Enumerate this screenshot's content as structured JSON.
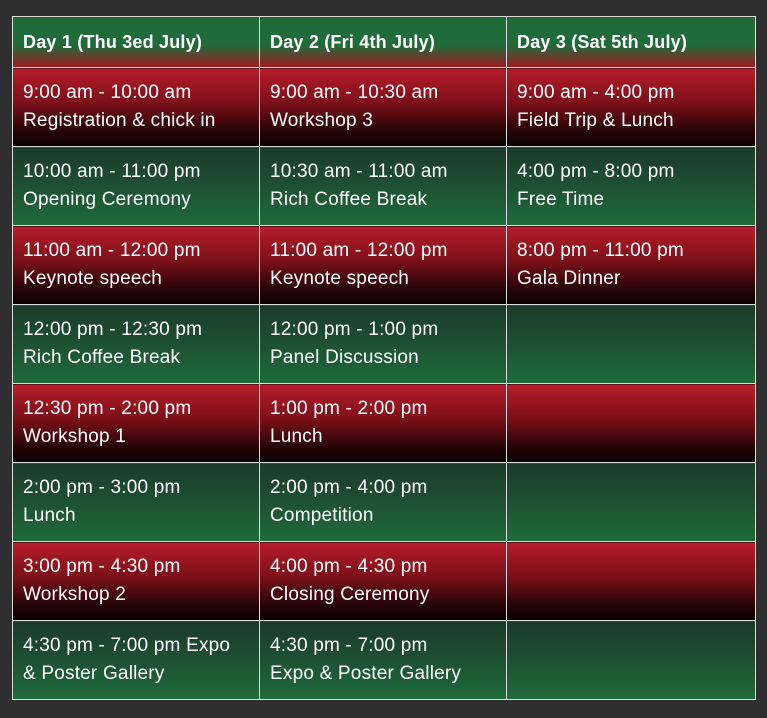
{
  "headers": [
    "Day 1 (Thu 3ed July)",
    "Day 2 (Fri 4th July)",
    "Day 3 (Sat 5th July)"
  ],
  "rows": [
    {
      "style": "red",
      "cells": [
        {
          "time": "9:00 am - 10:00 am",
          "event": "Registration & chick in"
        },
        {
          "time": "9:00 am - 10:30 am",
          "event": "Workshop 3"
        },
        {
          "time": "9:00 am - 4:00 pm",
          "event": "Field Trip & Lunch"
        }
      ]
    },
    {
      "style": "green",
      "cells": [
        {
          "time": "10:00 am - 11:00 pm",
          "event": "Opening Ceremony"
        },
        {
          "time": "10:30 am - 11:00 am",
          "event": "Rich Coffee Break"
        },
        {
          "time": "4:00 pm - 8:00 pm",
          "event": "Free Time"
        }
      ]
    },
    {
      "style": "red",
      "cells": [
        {
          "time": "11:00 am - 12:00 pm",
          "event": "Keynote speech"
        },
        {
          "time": "11:00 am - 12:00 pm",
          "event": "Keynote speech"
        },
        {
          "time": "8:00 pm - 11:00 pm",
          "event": "Gala Dinner"
        }
      ]
    },
    {
      "style": "green",
      "cells": [
        {
          "time": "12:00 pm - 12:30 pm",
          "event": "Rich Coffee Break"
        },
        {
          "time": "12:00 pm - 1:00 pm",
          "event": "Panel Discussion"
        },
        {
          "time": "",
          "event": ""
        }
      ]
    },
    {
      "style": "red",
      "cells": [
        {
          "time": "12:30 pm - 2:00 pm",
          "event": "Workshop 1"
        },
        {
          "time": "1:00 pm - 2:00 pm",
          "event": "Lunch"
        },
        {
          "time": "",
          "event": ""
        }
      ]
    },
    {
      "style": "green",
      "cells": [
        {
          "time": "2:00 pm - 3:00 pm",
          "event": "Lunch"
        },
        {
          "time": "2:00 pm - 4:00 pm",
          "event": "Competition"
        },
        {
          "time": "",
          "event": ""
        }
      ]
    },
    {
      "style": "red",
      "cells": [
        {
          "time": "3:00 pm - 4:30 pm",
          "event": "Workshop 2"
        },
        {
          "time": "4:00 pm - 4:30 pm",
          "event": "Closing Ceremony"
        },
        {
          "time": "",
          "event": ""
        }
      ]
    },
    {
      "style": "green",
      "cells": [
        {
          "time": "4:30 pm - 7:00 pm  Expo",
          "event": "& Poster Gallery"
        },
        {
          "time": "4:30 pm - 7:00 pm",
          "event": "Expo & Poster Gallery"
        },
        {
          "time": "",
          "event": ""
        }
      ]
    }
  ],
  "colors": {
    "red_top": "#b81c2b",
    "red_bottom": "#080202",
    "green_top": "#1c3a2a",
    "green_bottom": "#1f6b3c",
    "border": "#d9dde0",
    "background": "#2f2f2f",
    "text": "#ffffff"
  }
}
